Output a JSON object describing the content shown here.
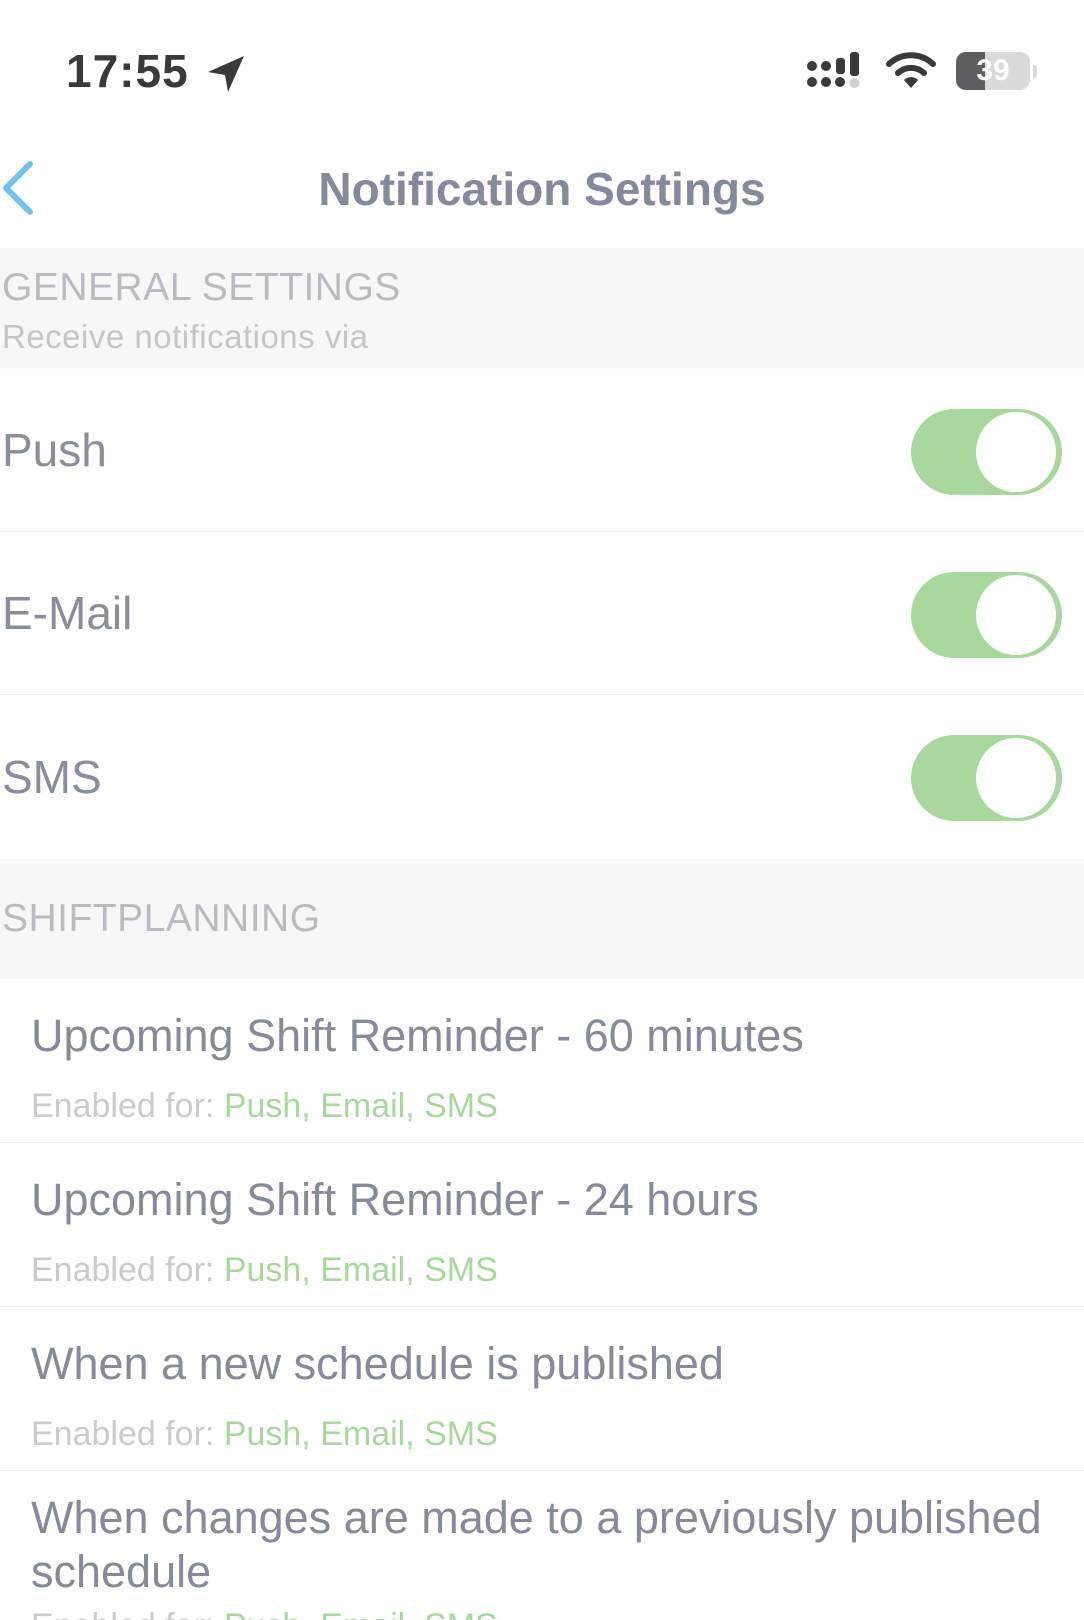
{
  "status_bar": {
    "time": "17:55",
    "battery": "39",
    "battery_level": 0.39,
    "icons": [
      "location-arrow-icon",
      "cellular-signal-icon",
      "wifi-icon",
      "battery-icon"
    ]
  },
  "nav": {
    "title": "Notification Settings",
    "back_icon": "chevron-left-icon"
  },
  "general": {
    "title": "GENERAL SETTINGS",
    "subtitle": "Receive notifications via",
    "items": [
      {
        "label": "Push",
        "enabled": true
      },
      {
        "label": "E-Mail",
        "enabled": true
      },
      {
        "label": "SMS",
        "enabled": true
      }
    ]
  },
  "shiftplanning": {
    "title": "SHIFTPLANNING",
    "items": [
      {
        "title": "Upcoming Shift Reminder - 60 minutes",
        "enabled_label": "Enabled for:",
        "channels": "Push, Email, SMS"
      },
      {
        "title": "Upcoming Shift Reminder - 24 hours",
        "enabled_label": "Enabled for:",
        "channels": "Push, Email, SMS"
      },
      {
        "title": "When a new schedule is published",
        "enabled_label": "Enabled for:",
        "channels": "Push, Email, SMS"
      },
      {
        "title": "When changes are made to a previously published schedule",
        "enabled_label": "Enabled for:",
        "channels": "Push, Email, SMS"
      }
    ]
  },
  "colors": {
    "accent_green": "#a8d89e",
    "back_blue": "#6ec3ef",
    "title_gray": "#848a99",
    "section_bg": "#f6f7f7"
  }
}
